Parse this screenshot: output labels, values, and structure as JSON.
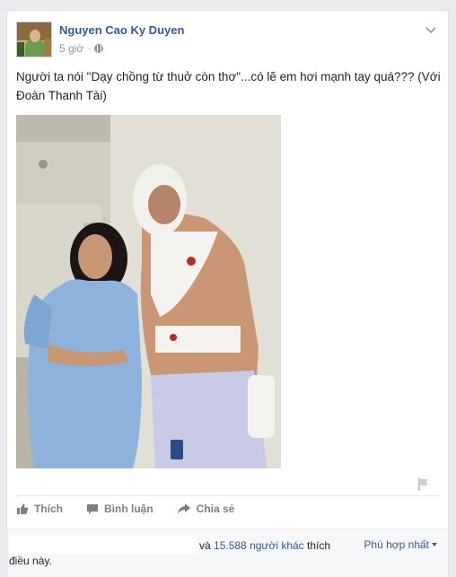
{
  "post": {
    "author": "Nguyen Cao Ky Duyen",
    "time": "5 giờ",
    "text": "Người ta nói \"Dạy chồng từ thuở còn thơ\"...có lẽ em hơi mạnh tay quá??? (Với Đoàn Thanh Tài)"
  },
  "actions": {
    "like": "Thích",
    "comment": "Bình luận",
    "share": "Chia sẻ"
  },
  "likes": {
    "prefix": "và",
    "count": "15.588 người khác",
    "suffix": "thích điều này."
  },
  "sort": {
    "label": "Phù hợp nhất"
  },
  "icons": {
    "privacy": "globe-icon",
    "menu": "chevron-down-icon",
    "report": "flag-icon",
    "like": "thumbs-up-icon",
    "comment": "speech-bubble-icon",
    "share": "share-arrow-icon"
  },
  "colors": {
    "link": "#365899",
    "meta": "#90949c",
    "action": "#7f7f7f",
    "background": "#e9ebee"
  }
}
